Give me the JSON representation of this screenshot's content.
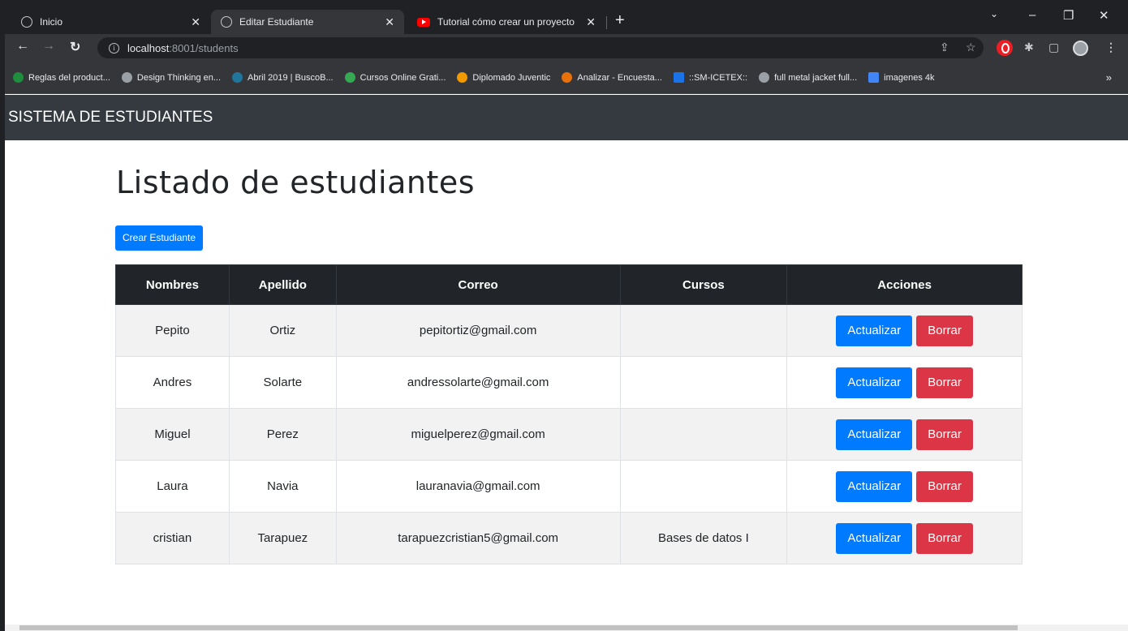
{
  "browser": {
    "tabs": [
      {
        "title": "Inicio",
        "icon": "globe-icon",
        "active": false
      },
      {
        "title": "Editar Estudiante",
        "icon": "globe-icon",
        "active": true
      },
      {
        "title": "Tutorial cómo crear un proyecto",
        "icon": "youtube-icon",
        "active": false
      }
    ],
    "url_host": "localhost",
    "url_path": ":8001/students",
    "bookmarks": [
      {
        "label": "Reglas del product...",
        "color": "#1e8e3e"
      },
      {
        "label": "Design Thinking en...",
        "color": "#9aa0a6"
      },
      {
        "label": "Abril 2019 | BuscoB...",
        "color": "#21759b"
      },
      {
        "label": "Cursos Online Grati...",
        "color": "#34a853"
      },
      {
        "label": "Diplomado Juventic",
        "color": "#f29900"
      },
      {
        "label": "Analizar - Encuesta...",
        "color": "#e8710a"
      },
      {
        "label": "::SM-ICETEX::",
        "color": "#1a73e8"
      },
      {
        "label": "full metal jacket full...",
        "color": "#9aa0a6"
      },
      {
        "label": "imagenes 4k",
        "color": "#4285f4"
      }
    ]
  },
  "navbar": {
    "brand": "SISTEMA DE ESTUDIANTES"
  },
  "page": {
    "title": "Listado de estudiantes",
    "create_button": "Crear Estudiante",
    "table": {
      "headers": [
        "Nombres",
        "Apellido",
        "Correo",
        "Cursos",
        "Acciones"
      ],
      "rows": [
        {
          "nombres": "Pepito",
          "apellido": "Ortiz",
          "correo": "pepitortiz@gmail.com",
          "cursos": ""
        },
        {
          "nombres": "Andres",
          "apellido": "Solarte",
          "correo": "andressolarte@gmail.com",
          "cursos": ""
        },
        {
          "nombres": "Miguel",
          "apellido": "Perez",
          "correo": "miguelperez@gmail.com",
          "cursos": ""
        },
        {
          "nombres": "Laura",
          "apellido": "Navia",
          "correo": "lauranavia@gmail.com",
          "cursos": ""
        },
        {
          "nombres": "cristian",
          "apellido": "Tarapuez",
          "correo": "tarapuezcristian5@gmail.com",
          "cursos": "Bases de datos I"
        }
      ],
      "update_label": "Actualizar",
      "delete_label": "Borrar"
    }
  },
  "colors": {
    "primary": "#007bff",
    "danger": "#dc3545",
    "navbar": "#343a40",
    "table_head": "#212529"
  }
}
